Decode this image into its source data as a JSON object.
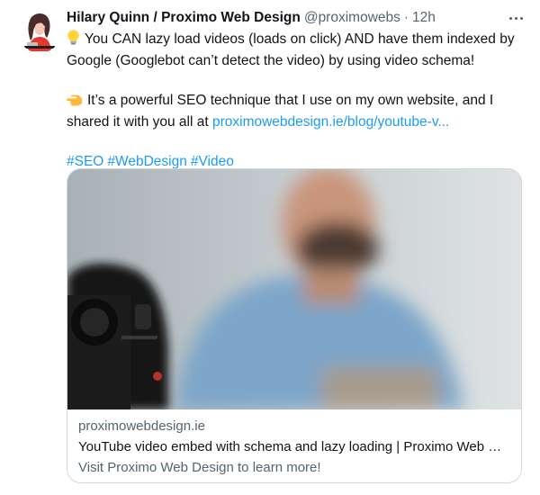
{
  "tweet": {
    "author_name": "Hilary Quinn / Proximo Web Design",
    "handle": "@proximowebs",
    "separator": "·",
    "time": "12h",
    "line1_text": "You CAN lazy load videos (loads on click) AND have them indexed by Google (Googlebot can’t detect the video) by using video schema!",
    "line2_text": "It’s a powerful SEO technique that I use on my own website, and I shared it with you all at ",
    "link_text": "proximowebdesign.ie/blog/youtube-v...",
    "hashtags": [
      "#SEO",
      "#WebDesign",
      "#Video"
    ],
    "icons": {
      "line1": "lightbulb-emoji",
      "line2": "pointing-hand-emoji",
      "more": "more-horizontal-icon"
    }
  },
  "card": {
    "domain": "proximowebdesign.ie",
    "title": "YouTube video embed with schema and lazy loading | Proximo Web Des...",
    "description": "Visit Proximo Web Design to learn more!"
  },
  "colors": {
    "link": "#1d9bf0",
    "secondary_text": "#536471",
    "primary_text": "#0f1419",
    "card_border": "#cfd9de"
  }
}
